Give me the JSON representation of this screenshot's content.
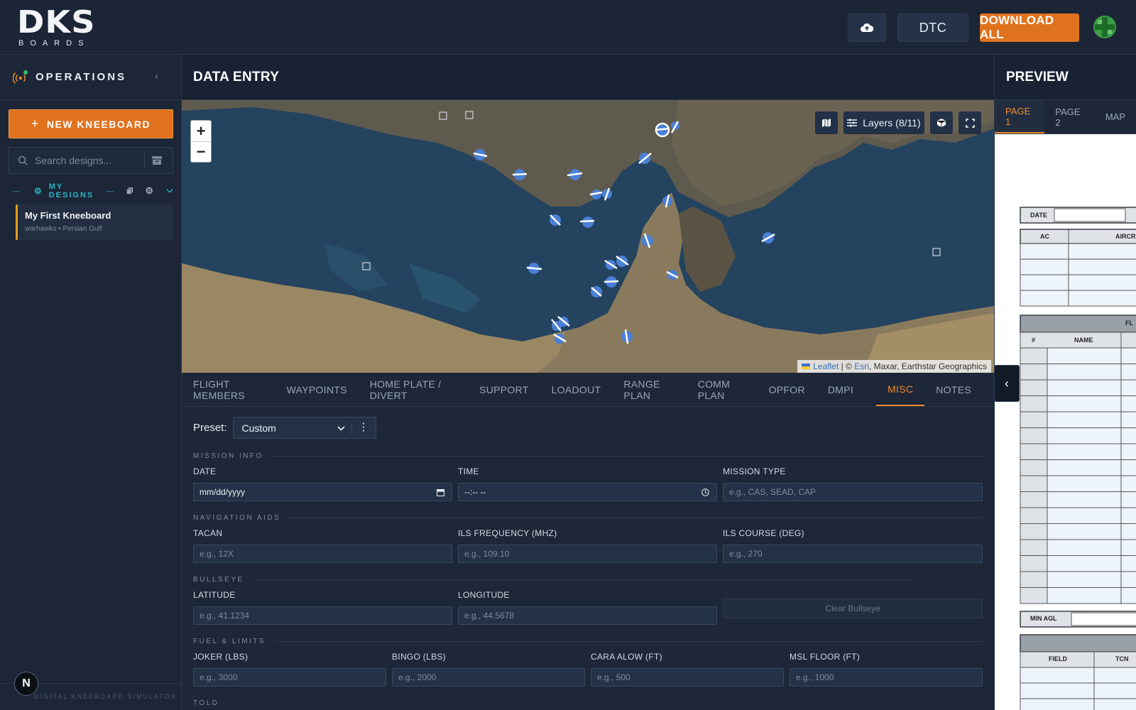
{
  "header": {
    "logo_mark": "DKS",
    "logo_sub": "BOARDS",
    "upload_icon": "cloud-upload-icon",
    "dtc_label": "DTC",
    "download_label": "DOWNLOAD ALL"
  },
  "sidebar": {
    "title": "OPERATIONS",
    "new_button": "NEW KNEEBOARD",
    "search_placeholder": "Search designs...",
    "designs_label": "MY DESIGNS",
    "designs": [
      {
        "name": "My First Kneeboard",
        "meta": "warhawks • Persian Gulf"
      }
    ],
    "footer": "DIGITAL KNEEBOARD SIMULATOR",
    "badge": "N"
  },
  "data_entry": {
    "title": "DATA ENTRY",
    "map": {
      "layers_label": "Layers (8/11)",
      "attribution_leaflet": "Leaflet",
      "attribution_sep": " | © ",
      "attribution_esri": "Esri",
      "attribution_rest": ", Maxar, Earthstar Geographics"
    },
    "tabs": [
      "FLIGHT MEMBERS",
      "WAYPOINTS",
      "HOME PLATE / DIVERT",
      "SUPPORT",
      "LOADOUT",
      "RANGE PLAN",
      "COMM PLAN",
      "OPFOR",
      "DMPI",
      "MISC",
      "NOTES"
    ],
    "active_tab": "MISC",
    "preset_label": "Preset:",
    "preset_value": "Custom",
    "sections": {
      "mission_info": "MISSION INFO",
      "nav_aids": "NAVIGATION AIDS",
      "bullseye": "BULLSEYE",
      "fuel": "FUEL & LIMITS",
      "told": "TOLD"
    },
    "fields": {
      "date": {
        "label": "DATE",
        "value": "mm/dd/yyyy"
      },
      "time": {
        "label": "TIME",
        "value": "--:-- --"
      },
      "mission_type": {
        "label": "MISSION TYPE",
        "placeholder": "e.g., CAS, SEAD, CAP"
      },
      "tacan": {
        "label": "TACAN",
        "placeholder": "e.g., 12X"
      },
      "ils_freq": {
        "label": "ILS FREQUENCY (MHZ)",
        "placeholder": "e.g., 109.10"
      },
      "ils_course": {
        "label": "ILS COURSE (DEG)",
        "placeholder": "e.g., 270"
      },
      "latitude": {
        "label": "LATITUDE",
        "placeholder": "e.g., 41.1234"
      },
      "longitude": {
        "label": "LONGITUDE",
        "placeholder": "e.g., 44.5678"
      },
      "clear_bullseye": "Clear Bullseye",
      "joker": {
        "label": "JOKER (LBS)",
        "placeholder": "e.g., 3000"
      },
      "bingo": {
        "label": "BINGO (LBS)",
        "placeholder": "e.g., 2000"
      },
      "cara": {
        "label": "CARA ALOW (FT)",
        "placeholder": "e.g., 500"
      },
      "msl": {
        "label": "MSL FLOOR (FT)",
        "placeholder": "e.g., 1000"
      }
    }
  },
  "preview": {
    "title": "PREVIEW",
    "tabs": [
      "PAGE 1",
      "PAGE 2",
      "MAP"
    ],
    "active_tab": "PAGE 1",
    "kneeboard": {
      "date_label": "DATE",
      "ac_label": "AC",
      "aircrew_label": "AIRCRE",
      "fl_label": "FL",
      "num_label": "#",
      "name_label": "NAME",
      "min_agl_label": "MIN AGL",
      "field_label": "FIELD",
      "tcn_label": "TCN"
    }
  }
}
